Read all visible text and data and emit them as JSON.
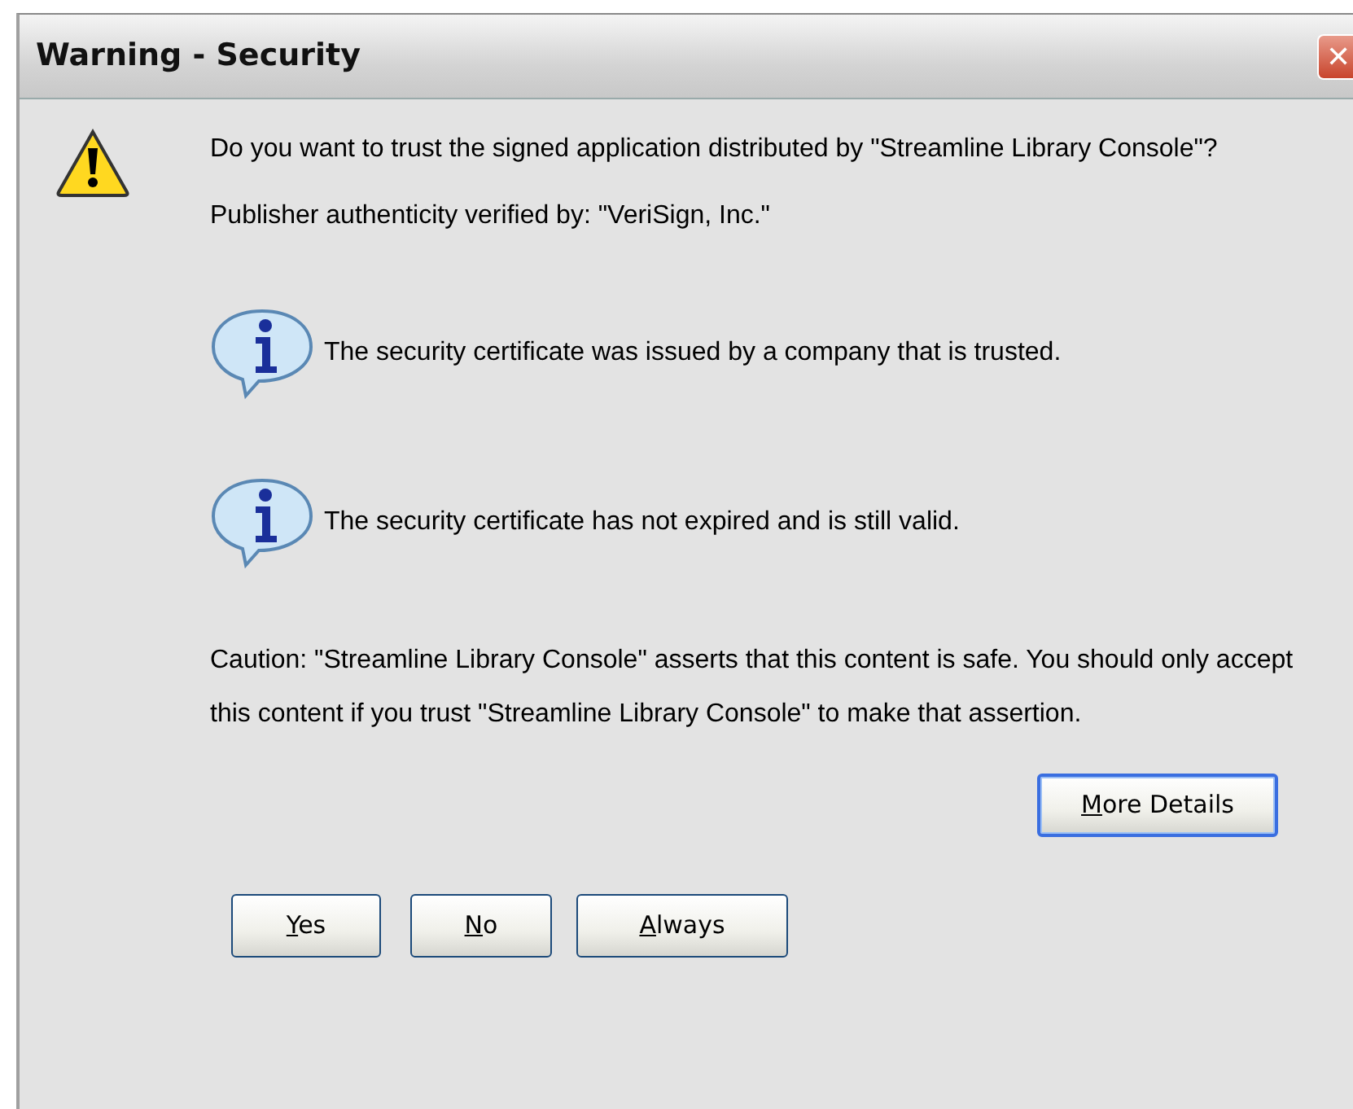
{
  "window": {
    "title": "Warning - Security",
    "close_glyph": "✕"
  },
  "question": "Do you want to trust the signed application distributed by \"Streamline Library Console\"?",
  "publisher": "Publisher authenticity verified by: \"VeriSign, Inc.\"",
  "notes": [
    {
      "kind": "info",
      "text": "The security certificate was issued by a company that is trusted."
    },
    {
      "kind": "info",
      "text": "The security certificate has not expired and is still valid."
    }
  ],
  "caution": "Caution: \"Streamline Library Console\" asserts that this content is safe. You should only accept this content if you trust \"Streamline Library Console\" to make that assertion.",
  "details_button": {
    "access_key": "M",
    "label_rest": "ore Details",
    "default": true
  },
  "buttons": [
    {
      "access_key": "Y",
      "label_rest": "es",
      "default": false
    },
    {
      "access_key": "N",
      "label_rest": "o",
      "default": false
    },
    {
      "access_key": "A",
      "label_rest": "lways",
      "default": false
    }
  ]
}
